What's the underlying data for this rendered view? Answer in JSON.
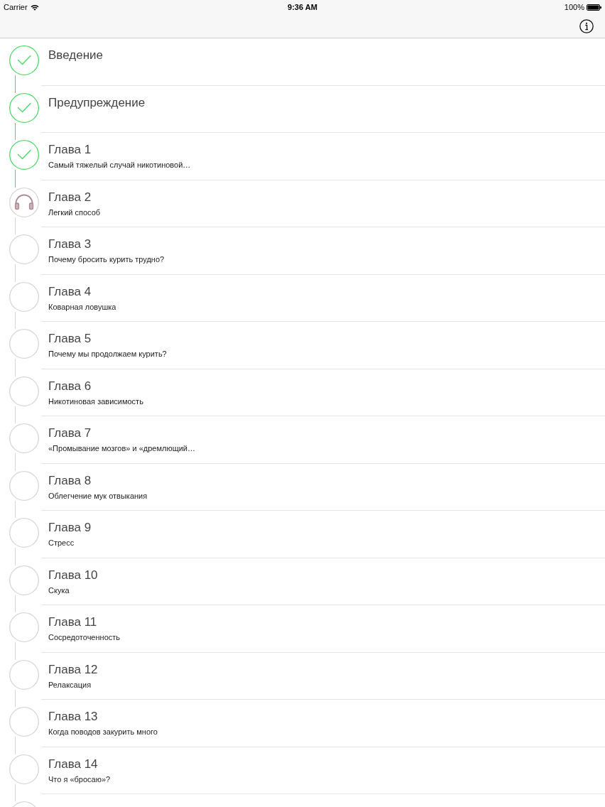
{
  "status_bar": {
    "carrier": "Carrier",
    "time": "9:36 AM",
    "battery": "100%"
  },
  "chapters": [
    {
      "title": "Введение",
      "completed": true,
      "current": false
    },
    {
      "title": "Предупреждение",
      "completed": true,
      "current": false
    },
    {
      "title": "Глава 1",
      "subtitle": "Самый тяжелый случай никотиновой…",
      "completed": true,
      "current": false
    },
    {
      "title": "Глава 2",
      "subtitle": "Легкий способ",
      "completed": false,
      "current": true
    },
    {
      "title": "Глава 3",
      "subtitle": "Почему бросить курить трудно?",
      "completed": false,
      "current": false
    },
    {
      "title": "Глава 4",
      "subtitle": "Коварная ловушка",
      "completed": false,
      "current": false
    },
    {
      "title": "Глава 5",
      "subtitle": "Почему мы продолжаем курить?",
      "completed": false,
      "current": false
    },
    {
      "title": "Глава 6",
      "subtitle": "Никотиновая зависимость",
      "completed": false,
      "current": false
    },
    {
      "title": "Глава 7",
      "subtitle": "«Промывание мозгов» и «дремлющий…",
      "completed": false,
      "current": false
    },
    {
      "title": "Глава 8",
      "subtitle": "Облегчение мук отвыкания",
      "completed": false,
      "current": false
    },
    {
      "title": "Глава 9",
      "subtitle": "Стресс",
      "completed": false,
      "current": false
    },
    {
      "title": "Глава 10",
      "subtitle": "Скука",
      "completed": false,
      "current": false
    },
    {
      "title": "Глава 11",
      "subtitle": "Сосредоточенность",
      "completed": false,
      "current": false
    },
    {
      "title": "Глава 12",
      "subtitle": "Релаксация",
      "completed": false,
      "current": false
    },
    {
      "title": "Глава 13",
      "subtitle": "Когда поводов закурить много",
      "completed": false,
      "current": false
    },
    {
      "title": "Глава 14",
      "subtitle": "Что я «бросаю»?",
      "completed": false,
      "current": false
    },
    {
      "completed": false
    }
  ]
}
